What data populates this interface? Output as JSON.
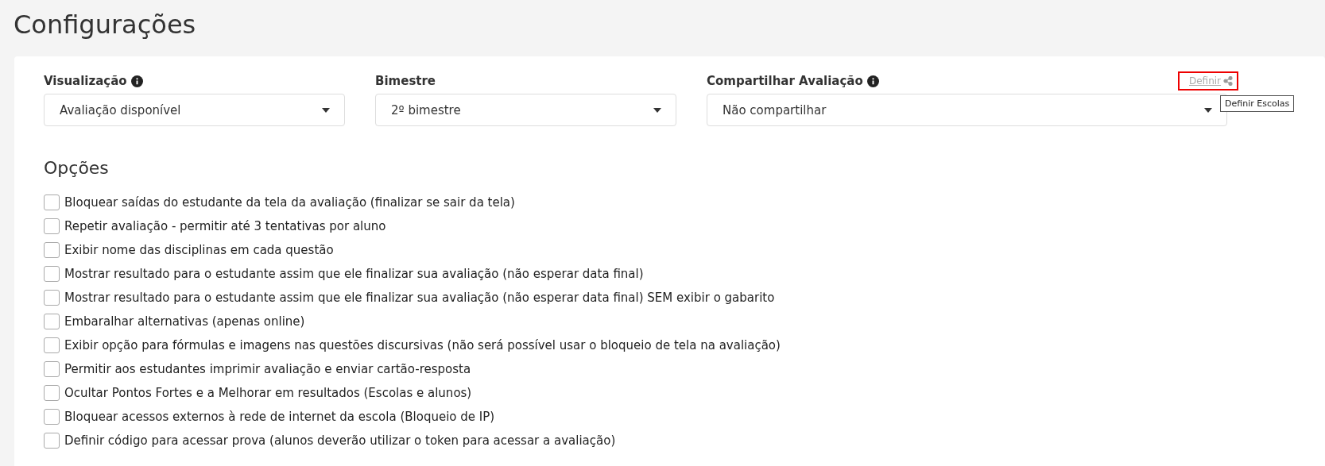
{
  "page_title": "Configurações",
  "fields": [
    {
      "label": "Visualização",
      "info": true,
      "value": "Avaliação disponível",
      "wide": false
    },
    {
      "label": "Bimestre",
      "info": false,
      "value": "2º bimestre",
      "wide": false
    },
    {
      "label": "Compartilhar Avaliação",
      "info": true,
      "value": "Não compartilhar",
      "wide": true
    }
  ],
  "share_link": {
    "label": "Definir",
    "highlighted": true,
    "tooltip": "Definir Escolas"
  },
  "options_title": "Opções",
  "options": [
    {
      "label": "Bloquear saídas do estudante da tela da avaliação (finalizar se sair da tela)",
      "checked": false
    },
    {
      "label": "Repetir avaliação - permitir até 3 tentativas por aluno",
      "checked": false
    },
    {
      "label": "Exibir nome das disciplinas em cada questão",
      "checked": false
    },
    {
      "label": "Mostrar resultado para o estudante assim que ele finalizar sua avaliação (não esperar data final)",
      "checked": false
    },
    {
      "label": "Mostrar resultado para o estudante assim que ele finalizar sua avaliação (não esperar data final) SEM exibir o gabarito",
      "checked": false
    },
    {
      "label": "Embaralhar alternativas (apenas online)",
      "checked": false
    },
    {
      "label": "Exibir opção para fórmulas e imagens nas questões discursivas (não será possível usar o bloqueio de tela na avaliação)",
      "checked": false
    },
    {
      "label": "Permitir aos estudantes imprimir avaliação e enviar cartão-resposta",
      "checked": false
    },
    {
      "label": "Ocultar Pontos Fortes e a Melhorar em resultados (Escolas e alunos)",
      "checked": false
    },
    {
      "label": "Bloquear acessos externos à rede de internet da escola (Bloqueio de IP)",
      "checked": false
    },
    {
      "label": "Definir código para acessar prova (alunos deverão utilizar o token para acessar a avaliação)",
      "checked": false
    }
  ]
}
